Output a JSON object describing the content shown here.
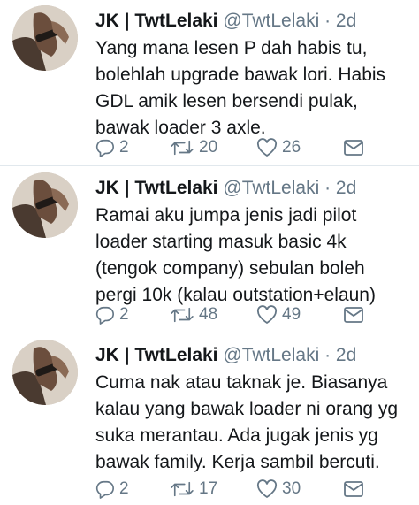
{
  "tweets": [
    {
      "name": "JK | TwtLelaki",
      "handle": "@TwtLelaki",
      "separator": "·",
      "time": "2d",
      "lines": [
        "Yang mana lesen P dah habis tu,",
        "bolehlah upgrade bawak lori. Habis",
        "GDL amik lesen bersendi pulak,",
        "bawak loader 3 axle."
      ],
      "replies": "2",
      "retweets": "20",
      "likes": "26"
    },
    {
      "name": "JK | TwtLelaki",
      "handle": "@TwtLelaki",
      "separator": "·",
      "time": "2d",
      "lines": [
        "Ramai aku jumpa jenis jadi pilot",
        "loader starting masuk basic 4k",
        "(tengok company) sebulan boleh",
        "pergi 10k (kalau outstation+elaun)"
      ],
      "replies": "2",
      "retweets": "48",
      "likes": "49"
    },
    {
      "name": "JK | TwtLelaki",
      "handle": "@TwtLelaki",
      "separator": "·",
      "time": "2d",
      "lines": [
        "Cuma nak atau taknak je. Biasanya",
        "kalau yang bawak loader ni orang yg",
        "suka merantau. Ada jugak jenis yg",
        "bawak family. Kerja sambil bercuti."
      ],
      "replies": "2",
      "retweets": "17",
      "likes": "30"
    }
  ],
  "icons": {
    "reply": "reply-icon",
    "retweet": "retweet-icon",
    "like": "heart-icon",
    "message": "envelope-icon"
  },
  "colors": {
    "text": "#14171a",
    "secondary": "#657786",
    "divider": "#e1e8ed"
  }
}
